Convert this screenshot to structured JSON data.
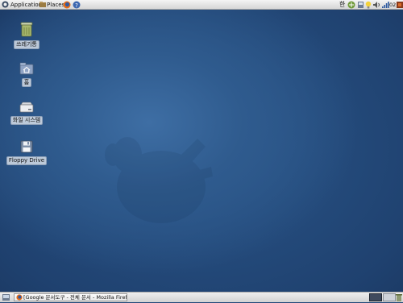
{
  "top_panel": {
    "applications_label": "Applications",
    "places_label": "Places",
    "input_method": "한",
    "clock": "02:28"
  },
  "desktop_icons": [
    {
      "label": "쓰레기통",
      "icon": "trash-icon"
    },
    {
      "label": "홈",
      "icon": "home-folder-icon"
    },
    {
      "label": "화일 시스템",
      "icon": "hard-drive-icon"
    },
    {
      "label": "Floppy Drive",
      "icon": "floppy-disk-icon"
    }
  ],
  "taskbar": {
    "window_button_label": "[Google 문서도구 - 전체 문서 - Mozilla Firefox]"
  },
  "colors": {
    "desktop_base": "#23497a",
    "panel": "#e2e2e2"
  }
}
